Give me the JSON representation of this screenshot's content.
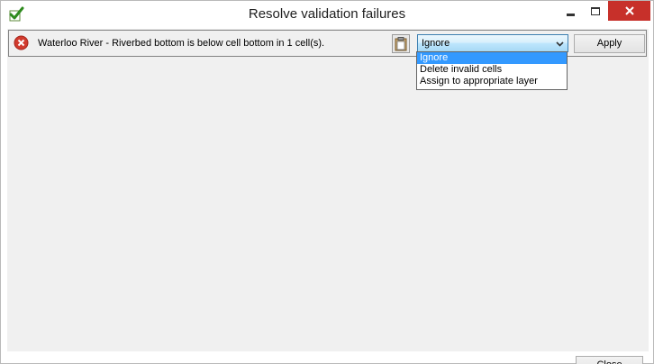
{
  "window": {
    "title": "Resolve validation failures",
    "app_icon": "checkmark-icon",
    "controls": {
      "minimize": "minimize-icon",
      "maximize": "maximize-icon",
      "close": "close-icon"
    },
    "close_button_color": "#c7302a"
  },
  "failure": {
    "status_icon": "error-icon",
    "status_color": "#d13b2e",
    "message": "Waterloo River - Riverbed bottom is below cell bottom in 1 cell(s).",
    "copy_icon": "clipboard-icon",
    "action": {
      "selected": "Ignore",
      "options": [
        "Ignore",
        "Delete invalid cells",
        "Assign to appropriate layer"
      ]
    },
    "apply_label": "Apply"
  },
  "footer": {
    "close_label": "Close"
  },
  "colors": {
    "selection": "#3399ff",
    "client_background": "#f0f0f0"
  }
}
